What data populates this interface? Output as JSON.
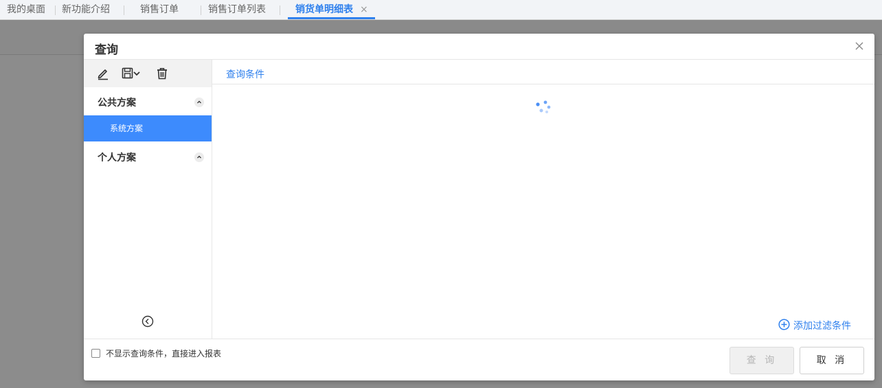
{
  "tabs": [
    {
      "label": "我的桌面",
      "active": false
    },
    {
      "label": "新功能介绍",
      "active": false
    },
    {
      "label": "销售订单",
      "active": false
    },
    {
      "label": "销售订单列表",
      "active": false
    },
    {
      "label": "销货单明细表",
      "active": true
    }
  ],
  "dialog": {
    "title": "查询",
    "left": {
      "toolbar_icons": [
        "edit-icon",
        "save-icon",
        "chevron-down-icon",
        "trash-icon"
      ],
      "groups": [
        {
          "label": "公共方案",
          "expanded": true,
          "items": [
            "系统方案"
          ]
        },
        {
          "label": "个人方案",
          "expanded": true,
          "items": []
        }
      ],
      "selected_item": "系统方案"
    },
    "right": {
      "tab_label": "查询条件",
      "add_filter_label": "添加过滤条件"
    },
    "footer": {
      "checkbox_label": "不显示查询条件，直接进入报表",
      "checkbox_checked": false,
      "query_button": "查 询",
      "cancel_button": "取 消"
    }
  },
  "colors": {
    "accent": "#2f80ed",
    "selected": "#3d8bfd",
    "overlay": "#8c8c8c"
  }
}
